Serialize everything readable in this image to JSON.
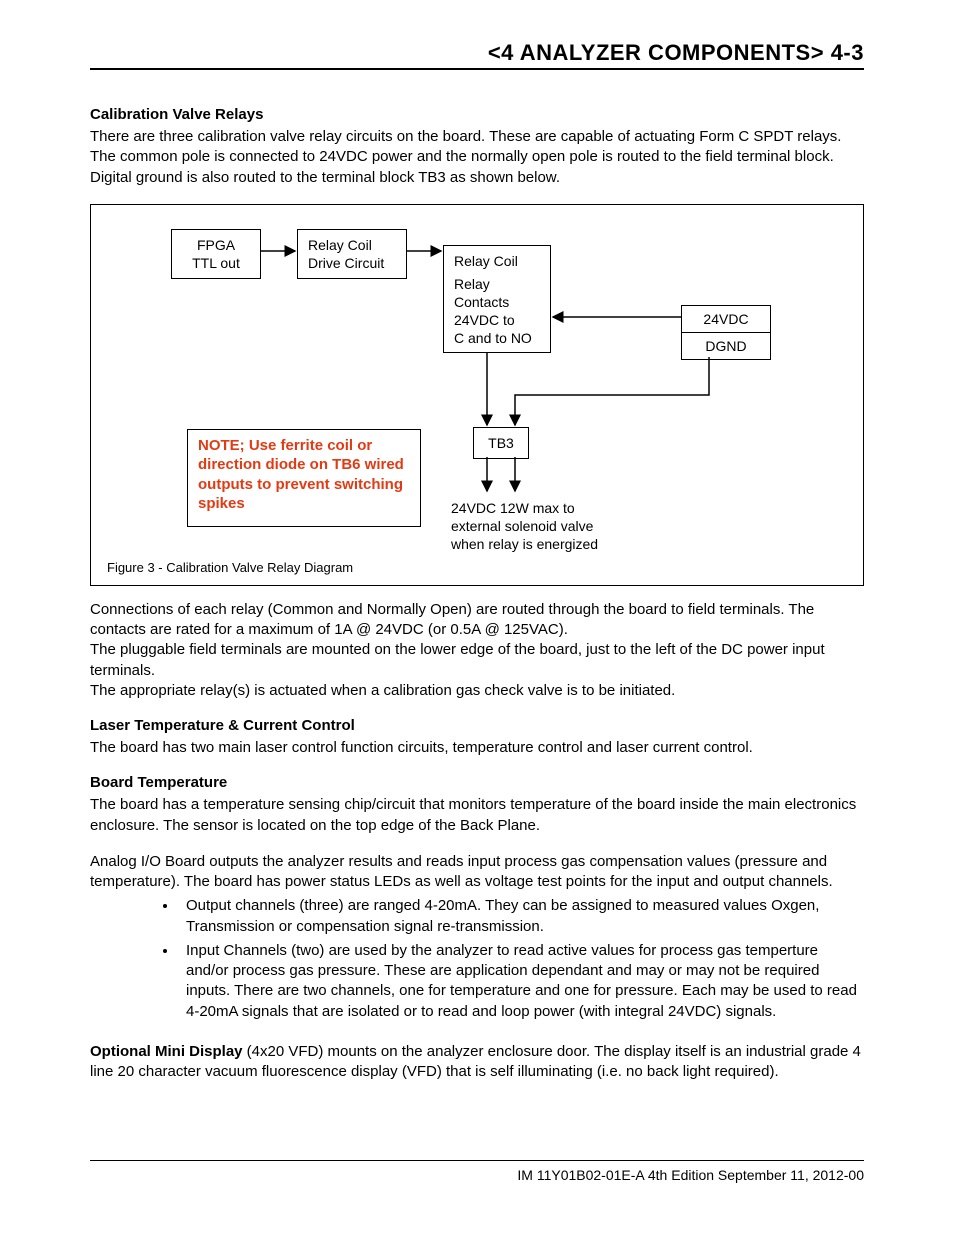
{
  "header": {
    "title": "<4 ANALYZER COMPONENTS>  4-3"
  },
  "sections": {
    "calib_relays": {
      "heading": "Calibration Valve Relays",
      "body": "There are three calibration valve relay circuits on the board. These are capable of actuating Form C SPDT relays. The common pole is connected to 24VDC power and the normally open pole is routed to the field terminal block. Digital ground is also routed to the terminal block TB3 as shown below."
    },
    "after_diagram": {
      "p1": "Connections of each relay (Common and Normally Open) are routed through the board to field terminals. The contacts are rated for a maximum of 1A @ 24VDC (or 0.5A @ 125VAC).",
      "p2": "The pluggable field terminals are mounted on the lower edge of the board, just to the left of the DC power input terminals.",
      "p3": "The appropriate relay(s) is actuated when a calibration gas check valve is to be initiated."
    },
    "laser": {
      "heading": "Laser Temperature & Current Control",
      "body": "The board has two main laser control function circuits, temperature control and laser current control."
    },
    "boardtemp": {
      "heading": "Board Temperature",
      "body": "The board has a temperature sensing chip/circuit that monitors temperature of the board inside the main electronics enclosure. The sensor is located on the top edge of the Back Plane."
    },
    "analog": {
      "body": "Analog I/O Board outputs the analyzer results and reads input process gas compensation values (pressure and temperature). The board has power status LEDs as well as voltage test points for the input and output channels.",
      "bullets": [
        "Output channels (three) are ranged 4-20mA. They can be assigned to measured values Oxgen, Transmission or compensation signal re-transmission.",
        "Input Channels (two) are used by the analyzer to read active values for process gas temperture and/or process gas pressure. These are application dependant and may or may not be required inputs. There are two channels, one for temperature and one for pressure. Each may be used to read 4-20mA signals that are isolated or to read and loop power (with integral 24VDC) signals."
      ]
    },
    "mini": {
      "lead": "Optional Mini Display",
      "body": " (4x20 VFD) mounts on the analyzer enclosure door. The display itself is an industrial grade 4 line 20 character vacuum fluorescence display (VFD) that is self illuminating (i.e. no back light required)."
    }
  },
  "diagram": {
    "fpga": "FPGA\nTTL out",
    "relay_drive": "Relay Coil\nDrive Circuit",
    "relay_coil": "Relay Coil",
    "relay_contacts": "Relay\nContacts\n24VDC to\nC and to NO",
    "vdc": "24VDC",
    "dgnd": "DGND",
    "tb3": "TB3",
    "note": "NOTE; Use ferrite coil or direction diode on TB6 wired outputs to prevent switching spikes",
    "outtext": "24VDC 12W max to\nexternal solenoid valve\nwhen relay is energized",
    "caption": "Figure 3 - Calibration Valve Relay Diagram"
  },
  "footer": {
    "text": "IM 11Y01B02-01E-A  4th Edition September 11, 2012-00"
  }
}
